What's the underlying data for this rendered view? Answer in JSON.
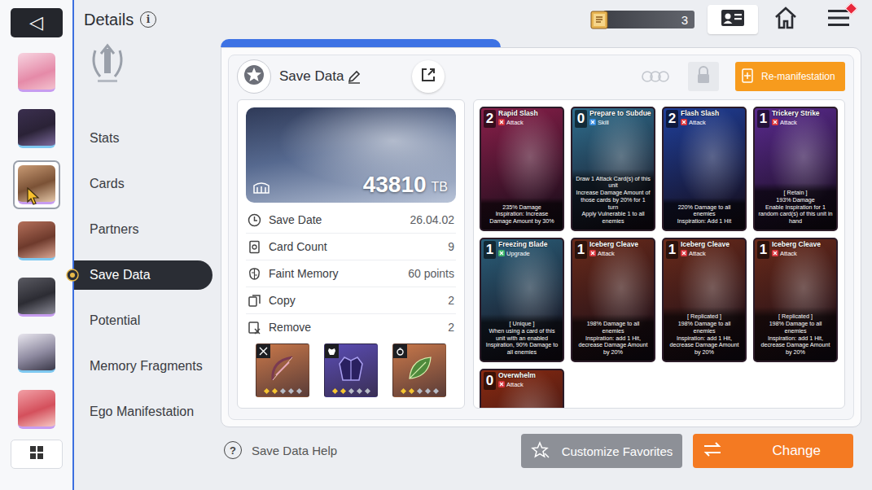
{
  "header": {
    "back_icon": "◁",
    "title": "Details",
    "info_icon": "i"
  },
  "currency": {
    "count": "3"
  },
  "menu": {
    "has_notification": true
  },
  "characters": [
    {
      "selected": false
    },
    {
      "selected": false
    },
    {
      "selected": true
    },
    {
      "selected": false
    },
    {
      "selected": false
    },
    {
      "selected": false
    },
    {
      "selected": false
    }
  ],
  "sidebar": {
    "items": [
      {
        "label": "Stats",
        "selected": false
      },
      {
        "label": "Cards",
        "selected": false
      },
      {
        "label": "Partners",
        "selected": false
      },
      {
        "label": "Save Data",
        "selected": true
      },
      {
        "label": "Potential",
        "selected": false
      },
      {
        "label": "Memory Fragments",
        "selected": false
      },
      {
        "label": "Ego Manifestation",
        "selected": false
      }
    ]
  },
  "panel": {
    "title": "Save Data",
    "action": "Re-manifestation"
  },
  "save": {
    "score": "43810",
    "unit": "TB",
    "stats": [
      {
        "label": "Save Date",
        "value": "26.04.02"
      },
      {
        "label": "Card Count",
        "value": "9"
      },
      {
        "label": "Faint Memory",
        "value": "60 points"
      },
      {
        "label": "Copy",
        "value": "2"
      },
      {
        "label": "Remove",
        "value": "2"
      }
    ],
    "equipment": [
      {
        "stars": 2,
        "color": "#c9784a"
      },
      {
        "stars": 2,
        "color": "#5a4cb4"
      },
      {
        "stars": 2,
        "color": "#c9784a"
      }
    ]
  },
  "cards": [
    {
      "cost": "2",
      "name": "Rapid Slash",
      "type": "Attack",
      "kind": "attack",
      "desc": [
        "235% Damage",
        "Inspiration: Increase Damage Amount by 30%"
      ],
      "color": "#8a1f4a"
    },
    {
      "cost": "0",
      "name": "Prepare to Subdue",
      "type": "Skill",
      "kind": "skill",
      "desc": [
        "Draw 1 Attack Card(s) of this unit",
        "Increase Damage Amount of those cards by 20% for 1 turn",
        "Apply Vulnerable 1 to all enemies"
      ],
      "color": "#2f6f8f"
    },
    {
      "cost": "2",
      "name": "Flash Slash",
      "type": "Attack",
      "kind": "attack",
      "desc": [
        "220% Damage to all enemies",
        "Inspiration: Add 1 Hit"
      ],
      "color": "#1f3f9a"
    },
    {
      "cost": "1",
      "name": "Trickery Strike",
      "type": "Attack",
      "kind": "attack",
      "tag": "[ Retain ]",
      "desc": [
        "193% Damage",
        "Enable Inspiration for 1 random card(s) of this unit in hand"
      ],
      "color": "#5a2a8f"
    },
    {
      "cost": "1",
      "name": "Freezing Blade",
      "type": "Upgrade",
      "kind": "upgrade",
      "tag": "[ Unique ]",
      "desc": [
        "When using a card of this unit with an enabled Inspiration, 90% Damage to all enemies"
      ],
      "color": "#2a5f7a"
    },
    {
      "cost": "1",
      "name": "Iceberg Cleave",
      "type": "Attack",
      "kind": "attack",
      "desc": [
        "198% Damage to all enemies",
        "Inspiration: add 1 Hit, decrease Damage Amount by 20%"
      ],
      "color": "#6a2a1a"
    },
    {
      "cost": "1",
      "name": "Iceberg Cleave",
      "type": "Attack",
      "kind": "attack",
      "tag": "[ Replicated ]",
      "desc": [
        "198% Damage to all enemies",
        "Inspiration: add 1 Hit, decrease Damage Amount by 20%"
      ],
      "color": "#6a2a1a"
    },
    {
      "cost": "1",
      "name": "Iceberg Cleave",
      "type": "Attack",
      "kind": "attack",
      "tag": "[ Replicated ]",
      "desc": [
        "198% Damage to all enemies",
        "Inspiration: add 1 Hit, decrease Damage Amount by 20%"
      ],
      "color": "#6a2a1a"
    },
    {
      "cost": "0",
      "name": "Overwhelm",
      "type": "Attack",
      "kind": "attack",
      "desc": [],
      "color": "#8a2a10"
    }
  ],
  "footer": {
    "help_icon": "?",
    "help": "Save Data Help",
    "favorites": "Customize Favorites",
    "change": "Change"
  }
}
